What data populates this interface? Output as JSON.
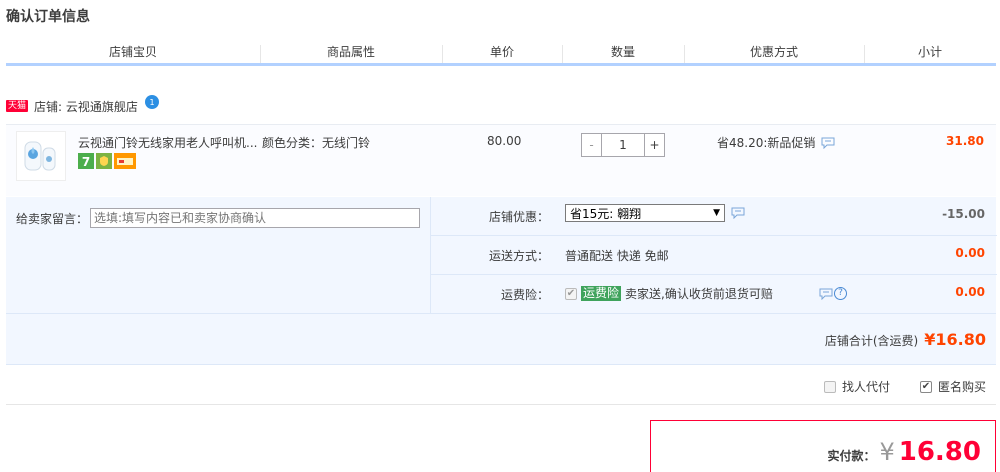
{
  "page": {
    "title": "确认订单信息"
  },
  "table_header": [
    "店铺宝贝",
    "商品属性",
    "单价",
    "数量",
    "优惠方式",
    "小计"
  ],
  "shop": {
    "badge": "天猫",
    "label": "店铺: 云视通旗舰店",
    "icon": "wangwang-chat-icon"
  },
  "item": {
    "title": "云视通门铃无线家用老人呼叫机...",
    "attribute": "颜色分类：无线门铃",
    "price": "80.00",
    "quantity": "1",
    "qty_minus": "-",
    "qty_plus": "+",
    "promotion": "省48.20:新品促销",
    "subtotal": "31.80",
    "service_icons": [
      "7-day-return-icon",
      "guarantee-icon",
      "credit-card-icon"
    ]
  },
  "message": {
    "label": "给卖家留言：",
    "placeholder": "选填:填写内容已和卖家协商确认"
  },
  "shop_discount": {
    "label": "店铺优惠：",
    "selected": "省15元: 翱翔",
    "amount": "-15.00"
  },
  "shipping": {
    "label": "运送方式：",
    "value": "普通配送 快递 免邮",
    "amount": "0.00"
  },
  "insurance": {
    "label": "运费险：",
    "badge": "运费险",
    "text": "卖家送,确认收货前退货可赔",
    "amount": "0.00",
    "help": "?"
  },
  "shop_total": {
    "label": "店铺合计(含运费)",
    "amount": "¥16.80"
  },
  "extras": {
    "proxy_pay": "找人代付",
    "anonymous": "匿名购买"
  },
  "payment": {
    "label": "实付款：",
    "currency": "¥",
    "amount": "16.80"
  },
  "colors": {
    "accent_red": "#ff4400",
    "brand_red": "#ff0036",
    "header_border": "#b2d1ff",
    "panel_bg": "#f2f7ff"
  }
}
